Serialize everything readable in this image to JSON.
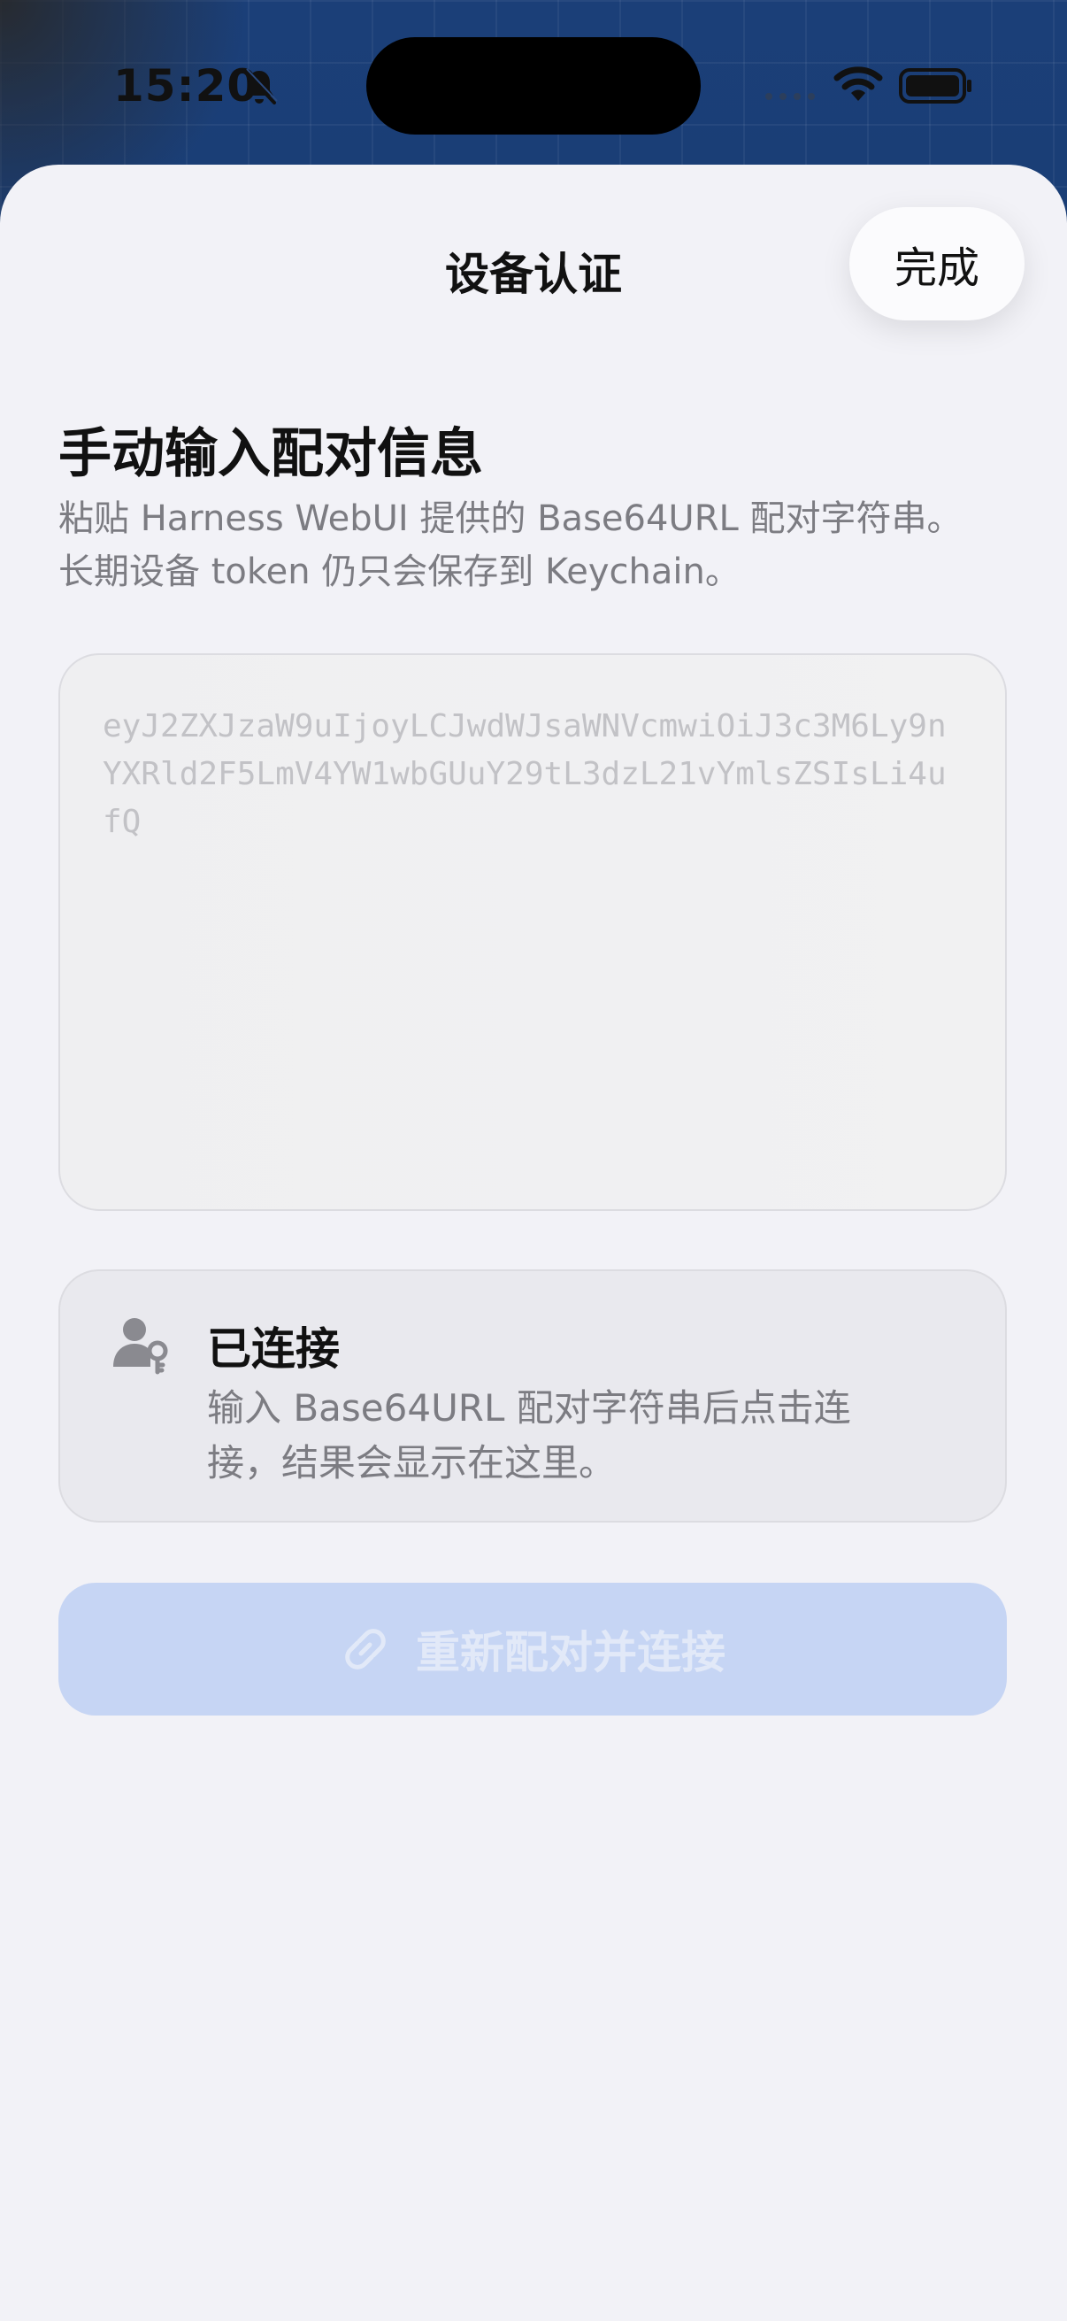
{
  "status_bar": {
    "time": "15:20",
    "icons": [
      "bell-slash-icon",
      "signal-icon",
      "wifi-icon",
      "battery-icon"
    ]
  },
  "sheet": {
    "title": "设备认证",
    "done_label": "完成"
  },
  "manual_entry": {
    "heading": "手动输入配对信息",
    "description": "粘贴 Harness WebUI 提供的 Base64URL 配对字符串。长期设备 token 仍只会保存到 Keychain。",
    "placeholder": "eyJ2ZXJzaW9uIjoyLCJwdWJsaWNVcmwiOiJ3c3M6Ly9nYXRld2F5LmV4YW1wbGUuY29tL3dzL21vYmlsZSIsLi4ufQ",
    "value": ""
  },
  "connection_status": {
    "icon": "person-key-icon",
    "title": "已连接",
    "description": "输入 Base64URL 配对字符串后点击连接，结果会显示在这里。"
  },
  "reconnect_button": {
    "icon": "link-icon",
    "label": "重新配对并连接",
    "enabled": false
  },
  "colors": {
    "sheet_background": "#f2f2f7",
    "accent_disabled": "#c6d5f4",
    "secondary_text": "#7c7c82"
  }
}
